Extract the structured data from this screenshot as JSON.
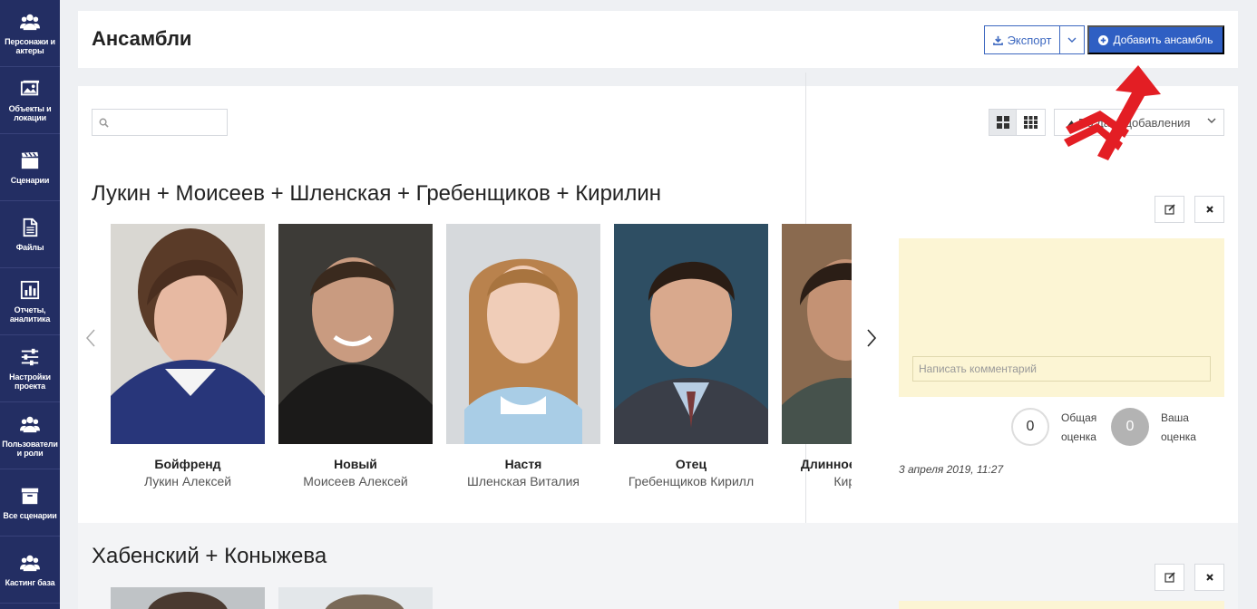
{
  "sidebar": {
    "items": [
      {
        "label": "Персонажи и актеры",
        "icon": "people-icon"
      },
      {
        "label": "Объекты и локации",
        "icon": "image-icon"
      },
      {
        "label": "Сценарии",
        "icon": "clapperboard-icon"
      },
      {
        "label": "Файлы",
        "icon": "file-icon"
      },
      {
        "label": "Отчеты, аналитика",
        "icon": "chart-icon"
      },
      {
        "label": "Настройки проекта",
        "icon": "sliders-icon"
      },
      {
        "label": "Пользователи и роли",
        "icon": "people-icon"
      },
      {
        "label": "Все сценарии",
        "icon": "archive-icon"
      },
      {
        "label": "Кастинг база",
        "icon": "people-icon"
      }
    ],
    "background": "#232e63"
  },
  "header": {
    "title": "Ансамбли",
    "export_label": "Экспорт",
    "add_label": "Добавить ансамбль"
  },
  "toolbar": {
    "search_placeholder": "",
    "sort_label": "По дате добавления"
  },
  "ensembles": [
    {
      "title": "Лукин + Моисеев + Шленская + Гребенщиков + Кирилин",
      "cards": [
        {
          "role": "Бойфренд",
          "actor": "Лукин Алексей"
        },
        {
          "role": "Новый",
          "actor": "Моисеев Алексей"
        },
        {
          "role": "Настя",
          "actor": "Шленская Виталия"
        },
        {
          "role": "Отец",
          "actor": "Гребенщиков Кирилл"
        },
        {
          "role": "Длинное имя перс",
          "actor": "Кирилин"
        }
      ],
      "comment_placeholder": "Написать комментарий",
      "total_score": "0",
      "total_score_label": "Общая оценка",
      "your_score": "0",
      "your_score_label": "Ваша оценка",
      "date": "3 апреля 2019, 11:27"
    },
    {
      "title": "Хабенский + Коныжева"
    }
  ],
  "colors": {
    "accent": "#2f5fc3",
    "note": "#fcf5d4",
    "annotation_arrow": "#e31e24"
  }
}
